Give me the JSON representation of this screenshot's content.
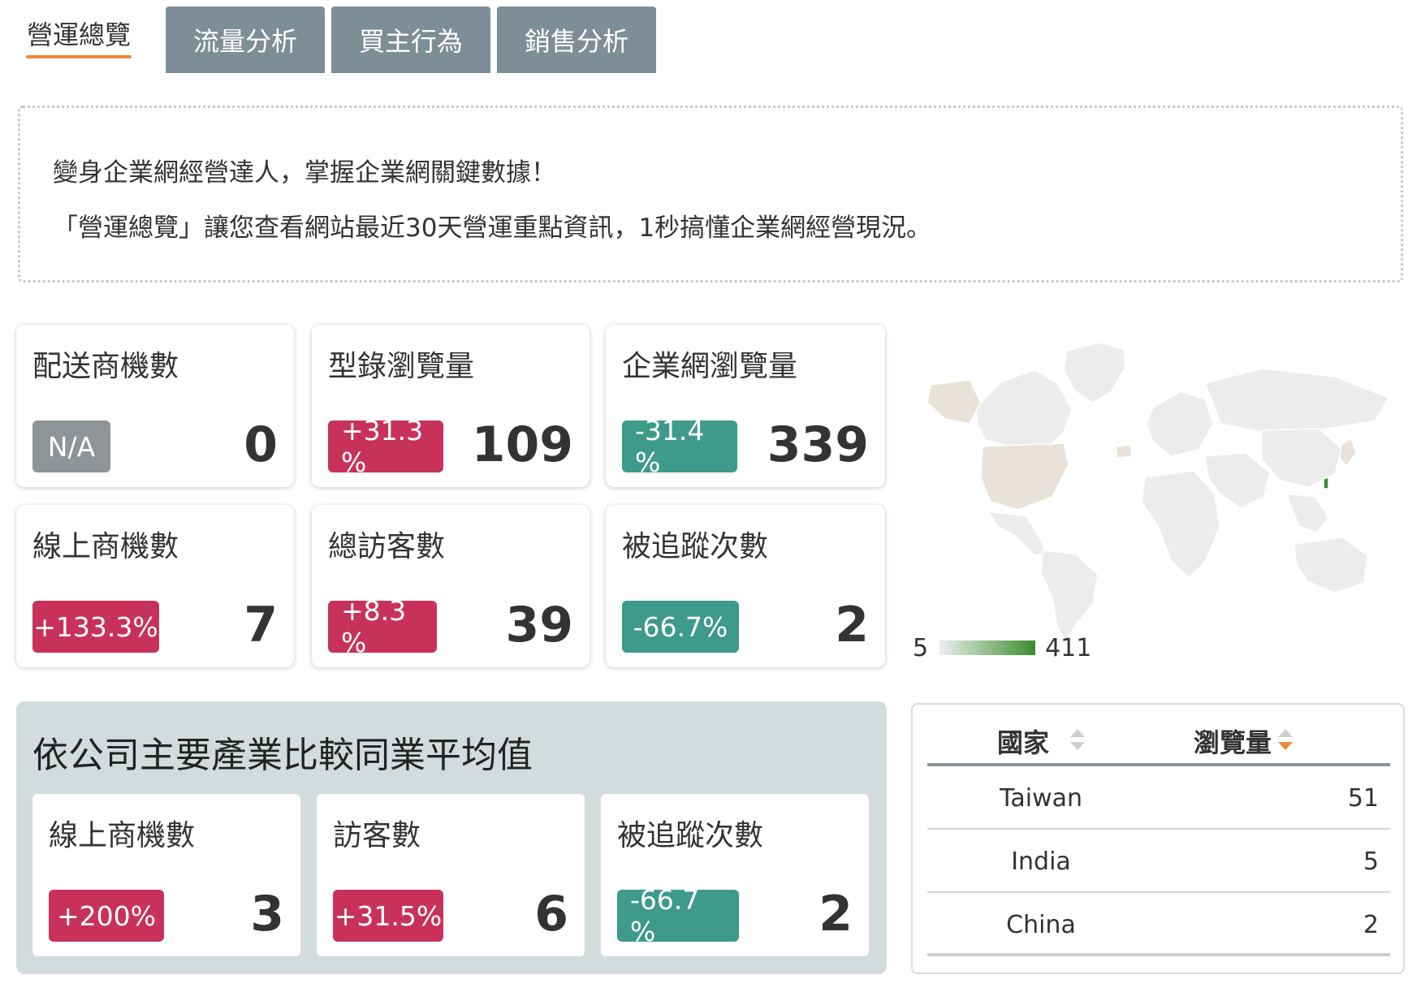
{
  "tabs": [
    {
      "label": "營運總覽",
      "active": true
    },
    {
      "label": "流量分析",
      "active": false
    },
    {
      "label": "買主行為",
      "active": false
    },
    {
      "label": "銷售分析",
      "active": false
    }
  ],
  "intro": {
    "line1": "變身企業網經營達人，掌握企業網關鍵數據！",
    "line2": "「營運總覽」讓您查看網站最近30天營運重點資訊，1秒搞懂企業網經營現況。"
  },
  "stats": [
    {
      "label": "配送商機數",
      "badge": "N/A",
      "badge_color": "#8e9497",
      "value": "0"
    },
    {
      "label": "型錄瀏覽量",
      "badge": "+31.3 %",
      "badge_color": "#c8325a",
      "value": "109"
    },
    {
      "label": "企業網瀏覽量",
      "badge": "-31.4 %",
      "badge_color": "#3e9a8a",
      "value": "339"
    },
    {
      "label": "線上商機數",
      "badge": "+133.3%",
      "badge_color": "#c8325a",
      "value": "7"
    },
    {
      "label": "總訪客數",
      "badge": "+8.3 %",
      "badge_color": "#c8325a",
      "value": "39"
    },
    {
      "label": "被追蹤次數",
      "badge": "-66.7%",
      "badge_color": "#3e9a8a",
      "value": "2"
    }
  ],
  "compare": {
    "title": "依公司主要產業比較同業平均值",
    "cards": [
      {
        "label": "線上商機數",
        "badge": "+200%",
        "badge_color": "#c8325a",
        "value": "3"
      },
      {
        "label": "訪客數",
        "badge": "+31.5%",
        "badge_color": "#c8325a",
        "value": "6"
      },
      {
        "label": "被追蹤次數",
        "badge": "-66.7 %",
        "badge_color": "#3e9a8a",
        "value": "2"
      }
    ]
  },
  "map_legend": {
    "min": "5",
    "max": "411",
    "color_min": "#eeeeee",
    "color_max": "#3b8e2e"
  },
  "country_table": {
    "headers": {
      "country": "國家",
      "views": "瀏覽量"
    },
    "sort_active_color": "#f0883a",
    "rows": [
      {
        "country": "Taiwan",
        "views": "51"
      },
      {
        "country": "India",
        "views": "5"
      },
      {
        "country": "China",
        "views": "2"
      }
    ]
  }
}
